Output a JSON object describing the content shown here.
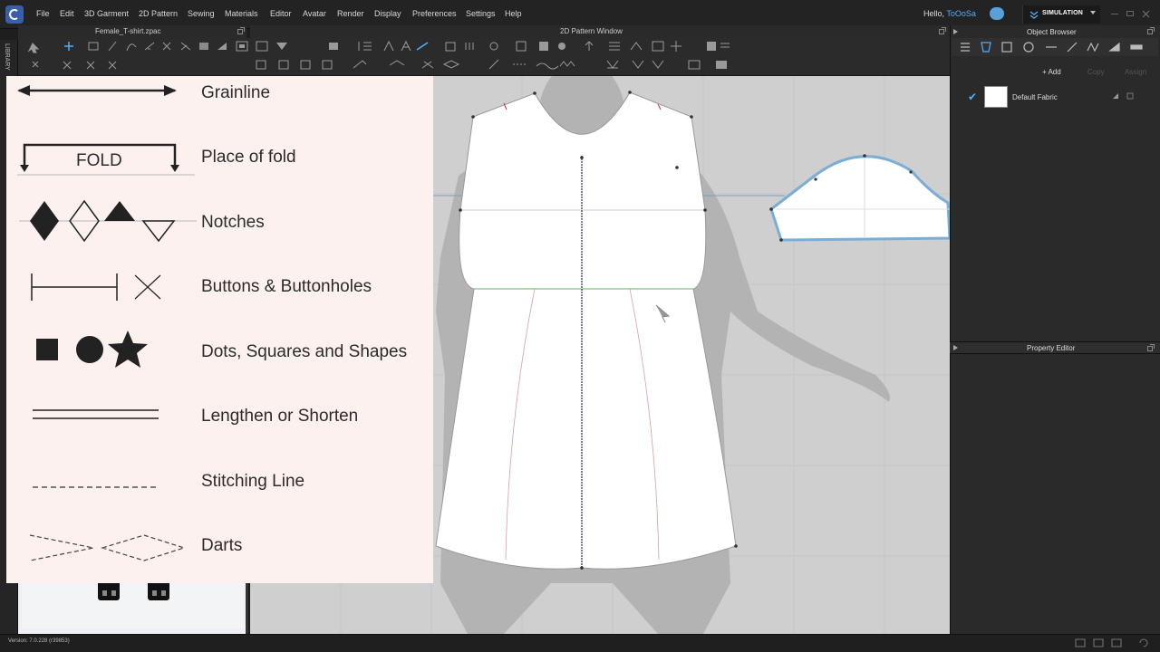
{
  "menubar": {
    "items": [
      "File",
      "Edit",
      "3D Garment",
      "2D Pattern",
      "Sewing",
      "Materials",
      "Editor",
      "Avatar",
      "Render",
      "Display",
      "Preferences",
      "Settings",
      "Help"
    ],
    "greeting": "Hello,",
    "user": "ToOoSa",
    "mode": "SIMULATION"
  },
  "sidebar": {
    "label": "LIBRARY"
  },
  "windows": {
    "file_name": "Female_T-shirt.zpac",
    "pattern_window_title": "2D Pattern Window"
  },
  "legend": {
    "items": [
      {
        "label": "Grainline"
      },
      {
        "label": "Place of fold",
        "symbol_text": "FOLD"
      },
      {
        "label": "Notches"
      },
      {
        "label": "Buttons & Buttonholes"
      },
      {
        "label": "Dots,  Squares and Shapes"
      },
      {
        "label": "Lengthen or Shorten"
      },
      {
        "label": "Stitching Line"
      },
      {
        "label": "Darts"
      }
    ]
  },
  "object_browser": {
    "title": "Object Browser",
    "add_label": "+ Add",
    "copy_label": "Copy",
    "assign_label": "Assign",
    "fabric_name": "Default Fabric"
  },
  "property_editor": {
    "title": "Property Editor"
  },
  "status": {
    "version": "Version: 7.0.228 (r39853)"
  },
  "colors": {
    "accent": "#4fb0ff",
    "legend_bg": "#fdf1ef",
    "pattern_bg": "#cfcfcf",
    "sleeve_outline": "#7aaed6",
    "waist_seam": "#5cb85c"
  }
}
